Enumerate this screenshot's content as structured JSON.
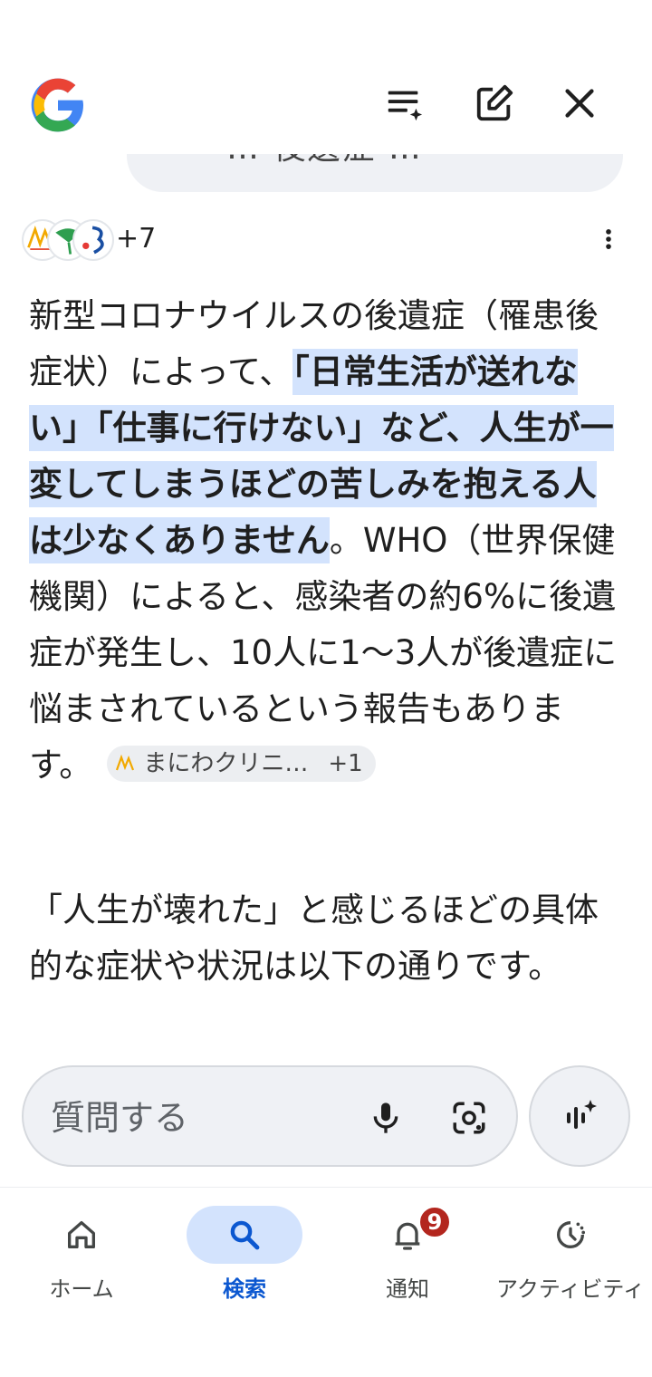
{
  "header": {
    "logo_icon": "google-g-logo",
    "icons": [
      "summary-sparkle-icon",
      "edit-icon",
      "close-icon"
    ]
  },
  "previous_query": {
    "text_fragment": "… 後遺症 …"
  },
  "sources": {
    "icons": [
      "manibawa-clinic-logo",
      "ginkgo-leaf-logo",
      "blue-red-logo"
    ],
    "more_count": "+7"
  },
  "answer": {
    "part1": "新型コロナウイルスの後遺症（罹患後症状）によって、",
    "highlight": "「日常生活が送れない」「仕事に行けない」など、人生が一変してしまうほどの苦しみを抱える人は少なくありません",
    "part2": "。WHO（世界保健機関）によると、感染者の約6%に後遺症が発生し、10人に1〜3人が後遺症に悩まされているという報告もあります。",
    "citation_label": "まにわクリニ…",
    "citation_more": "+1",
    "paragraph2": "「人生が壊れた」と感じるほどの具体的な症状や状況は以下の通りです。"
  },
  "ask_bar": {
    "placeholder": "質問する"
  },
  "bottom_nav": {
    "items": [
      {
        "label": "ホーム",
        "icon": "home-icon"
      },
      {
        "label": "検索",
        "icon": "search-icon"
      },
      {
        "label": "通知",
        "icon": "bell-icon",
        "badge": "9"
      },
      {
        "label": "アクティビティ",
        "icon": "activity-icon"
      }
    ],
    "active_index": 1
  },
  "colors": {
    "highlight": "#d3e3fd",
    "active_nav": "#0b57d0",
    "badge": "#b3261e"
  }
}
